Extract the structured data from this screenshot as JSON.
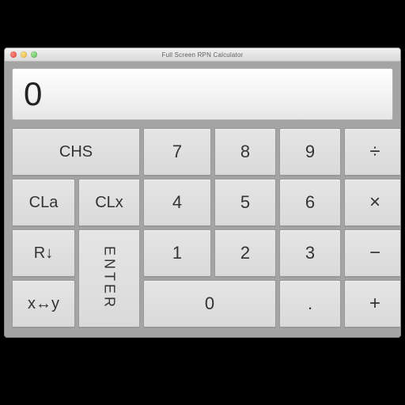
{
  "window": {
    "title": "Full Screen RPN Calculator"
  },
  "display": {
    "value": "0"
  },
  "keys": {
    "chs": "CHS",
    "d7": "7",
    "d8": "8",
    "d9": "9",
    "div": "÷",
    "cla": "CLa",
    "clx": "CLx",
    "d4": "4",
    "d5": "5",
    "d6": "6",
    "mul": "×",
    "rdown": "R↓",
    "enter": "ENTER",
    "d1": "1",
    "d2": "2",
    "d3": "3",
    "sub": "−",
    "xswap": "x↔y",
    "d0": "0",
    "dot": ".",
    "add": "+"
  }
}
